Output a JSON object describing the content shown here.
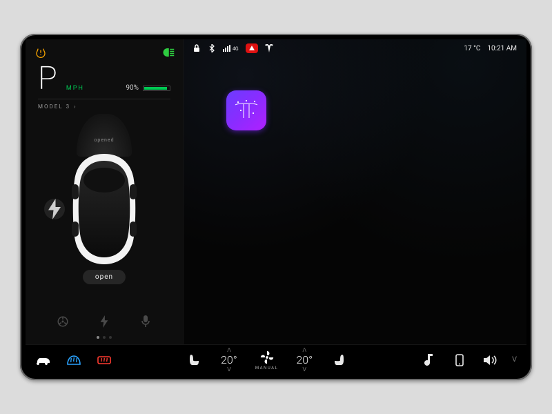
{
  "statusbar": {
    "signal_label": "4G",
    "temp": "17 °C",
    "time": "10:21 AM"
  },
  "left": {
    "gear": "P",
    "speed_unit": "MPH",
    "battery_pct": "90%",
    "model": "MODEL 3",
    "hood_status": "opened",
    "trunk_button": "open"
  },
  "dock": {
    "temp_left": "20°",
    "temp_right": "20°",
    "fan_mode": "MANUAL"
  },
  "pager": {
    "count": 3,
    "active": 0
  }
}
